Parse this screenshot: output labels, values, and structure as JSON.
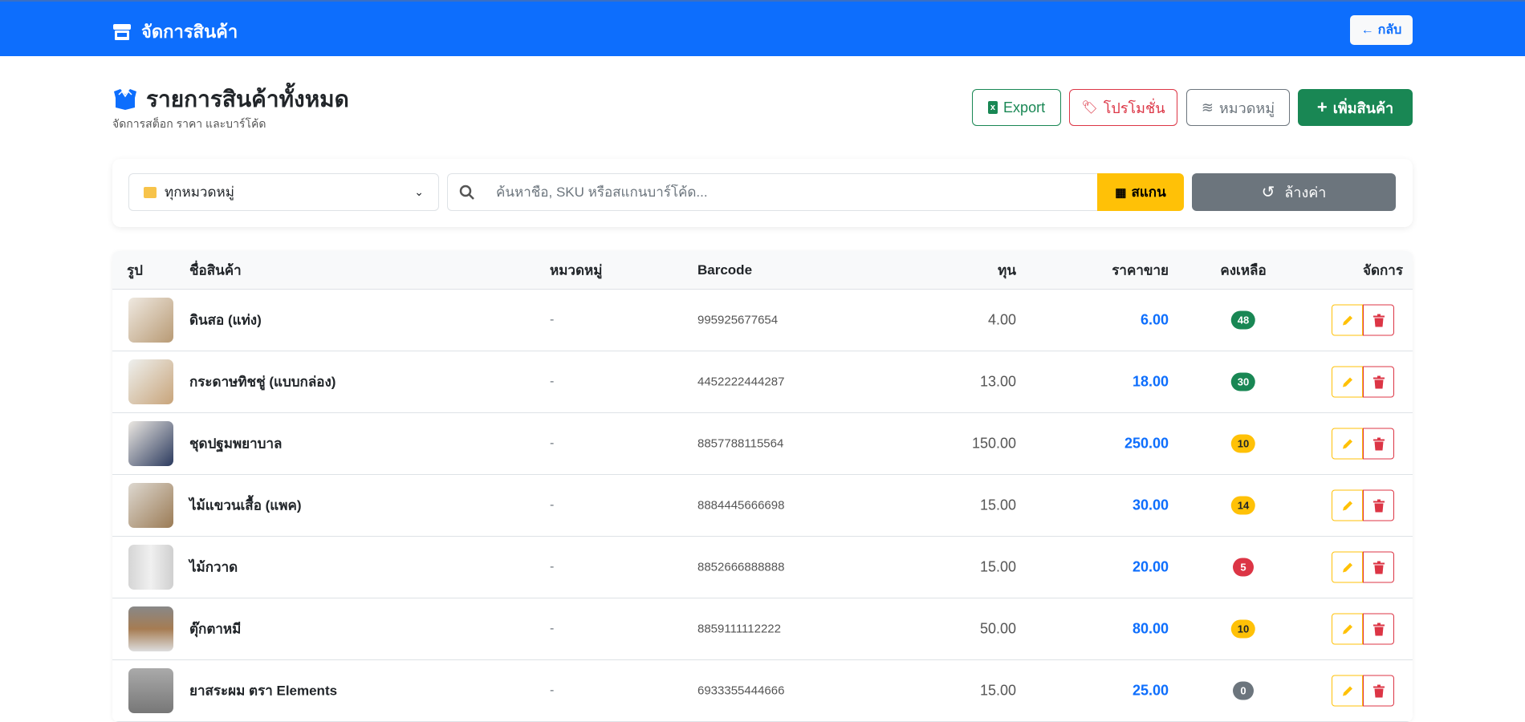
{
  "header": {
    "title": "จัดการสินค้า",
    "back_label": "กลับ"
  },
  "page": {
    "title": "รายการสินค้าทั้งหมด",
    "subtitle": "จัดการสต็อก ราคา และบาร์โค้ด"
  },
  "toolbar": {
    "export": "Export",
    "promotion": "โปรโมชั่น",
    "category": "หมวดหมู่",
    "add": "เพิ่มสินค้า"
  },
  "filters": {
    "category_selected": "ทุกหมวดหมู่",
    "search_placeholder": "ค้นหาชื่อ, SKU หรือสแกนบาร์โค้ด...",
    "scan": "สแกน",
    "reset": "ล้างค่า"
  },
  "table": {
    "headers": [
      "รูป",
      "ชื่อสินค้า",
      "หมวดหมู่",
      "Barcode",
      "ทุน",
      "ราคาขาย",
      "คงเหลือ",
      "จัดการ"
    ],
    "rows": [
      {
        "name": "ดินสอ (แท่ง)",
        "category": "-",
        "barcode": "995925677654",
        "cost": "4.00",
        "price": "6.00",
        "stock": "48",
        "status": "ok"
      },
      {
        "name": "กระดาษทิชชู่ (แบบกล่อง)",
        "category": "-",
        "barcode": "4452222444287",
        "cost": "13.00",
        "price": "18.00",
        "stock": "30",
        "status": "ok"
      },
      {
        "name": "ชุดปฐมพยาบาล",
        "category": "-",
        "barcode": "8857788115564",
        "cost": "150.00",
        "price": "250.00",
        "stock": "10",
        "status": "low"
      },
      {
        "name": "ไม้แขวนเสื้อ (แพค)",
        "category": "-",
        "barcode": "8884445666698",
        "cost": "15.00",
        "price": "30.00",
        "stock": "14",
        "status": "low"
      },
      {
        "name": "ไม้กวาด",
        "category": "-",
        "barcode": "8852666888888",
        "cost": "15.00",
        "price": "20.00",
        "stock": "5",
        "status": "critical"
      },
      {
        "name": "ตุ๊กตาหมี",
        "category": "-",
        "barcode": "8859111112222",
        "cost": "50.00",
        "price": "80.00",
        "stock": "10",
        "status": "low"
      },
      {
        "name": "ยาสระผม ตรา Elements",
        "category": "-",
        "barcode": "6933355444666",
        "cost": "15.00",
        "price": "25.00",
        "stock": "0",
        "status": "out"
      }
    ]
  },
  "colors": {
    "primary": "#0d6efd",
    "success": "#198754",
    "warning": "#ffc107",
    "danger": "#dc3545",
    "secondary": "#6c757d"
  }
}
